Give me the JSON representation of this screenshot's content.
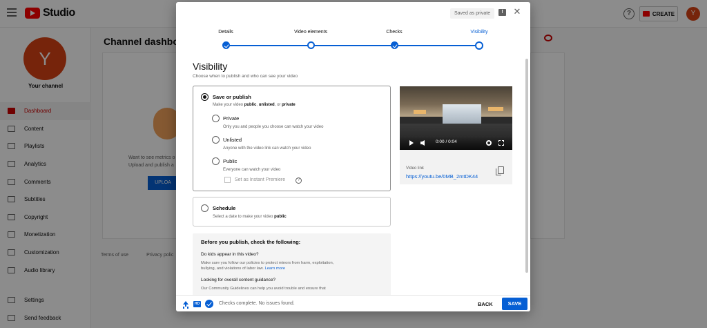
{
  "studio": {
    "logo_text": "Studio",
    "create_label": "CREATE",
    "avatar_letter": "Y",
    "help_glyph": "?",
    "channel_label": "Your channel",
    "dashboard_title": "Channel dashboard",
    "metrics_line1": "Want to see metrics o",
    "metrics_line2": "Upload and publish a",
    "upload_label": "UPLOA",
    "footer_terms": "Terms of use",
    "footer_privacy": "Privacy polic",
    "nav": [
      {
        "label": "Dashboard",
        "icon": "dashboard-icon",
        "active": true
      },
      {
        "label": "Content",
        "icon": "content-icon"
      },
      {
        "label": "Playlists",
        "icon": "playlists-icon"
      },
      {
        "label": "Analytics",
        "icon": "analytics-icon"
      },
      {
        "label": "Comments",
        "icon": "comments-icon"
      },
      {
        "label": "Subtitles",
        "icon": "subtitles-icon"
      },
      {
        "label": "Copyright",
        "icon": "copyright-icon"
      },
      {
        "label": "Monetization",
        "icon": "monetization-icon"
      },
      {
        "label": "Customization",
        "icon": "customization-icon"
      },
      {
        "label": "Audio library",
        "icon": "audio-library-icon"
      }
    ],
    "nav_bottom": [
      {
        "label": "Settings",
        "icon": "settings-icon"
      },
      {
        "label": "Send feedback",
        "icon": "feedback-icon"
      }
    ]
  },
  "dialog": {
    "saved_badge": "Saved as private",
    "close_glyph": "✕",
    "steps": [
      {
        "label": "Details",
        "state": "done"
      },
      {
        "label": "Video elements",
        "state": "current-past"
      },
      {
        "label": "Checks",
        "state": "done"
      },
      {
        "label": "Visibility",
        "state": "current"
      }
    ],
    "title": "Visibility",
    "subtitle": "Choose when to publish and who can see your video",
    "save_publish": {
      "label": "Save or publish",
      "desc_pre": "Make your video ",
      "desc_public": "public",
      "desc_sep1": ", ",
      "desc_unlisted": "unlisted",
      "desc_sep2": ", or ",
      "desc_private": "private"
    },
    "options": [
      {
        "label": "Private",
        "desc": "Only you and people you choose can watch your video"
      },
      {
        "label": "Unlisted",
        "desc": "Anyone with the video link can watch your video"
      },
      {
        "label": "Public",
        "desc": "Everyone can watch your video"
      }
    ],
    "premiere_label": "Set as Instant Premiere",
    "info_glyph": "?",
    "schedule": {
      "label": "Schedule",
      "desc_pre": "Select a date to make your video ",
      "desc_bold": "public"
    },
    "checklist": {
      "title": "Before you publish, check the following:",
      "q1": "Do kids appear in this video?",
      "p1_a": "Make sure you follow our policies to protect minors from harm, exploitation,",
      "p1_b": "bullying, and violations of labor law. ",
      "p1_link": "Learn more",
      "q2": "Looking for overall content guidance?",
      "p2_a": "Our Community Guidelines can help you avoid trouble and ensure that"
    },
    "video": {
      "time": "0:00 / 0:04",
      "link_label": "Video link",
      "link_url": "https://youtu.be/0MB_2mtDK44"
    },
    "footer": {
      "hd_glyph": "HD",
      "status": "Checks complete. No issues found.",
      "back_label": "BACK",
      "save_label": "SAVE"
    }
  },
  "colors": {
    "accent": "#065fd4",
    "brand_red": "#ff0000",
    "avatar": "#d84315"
  }
}
